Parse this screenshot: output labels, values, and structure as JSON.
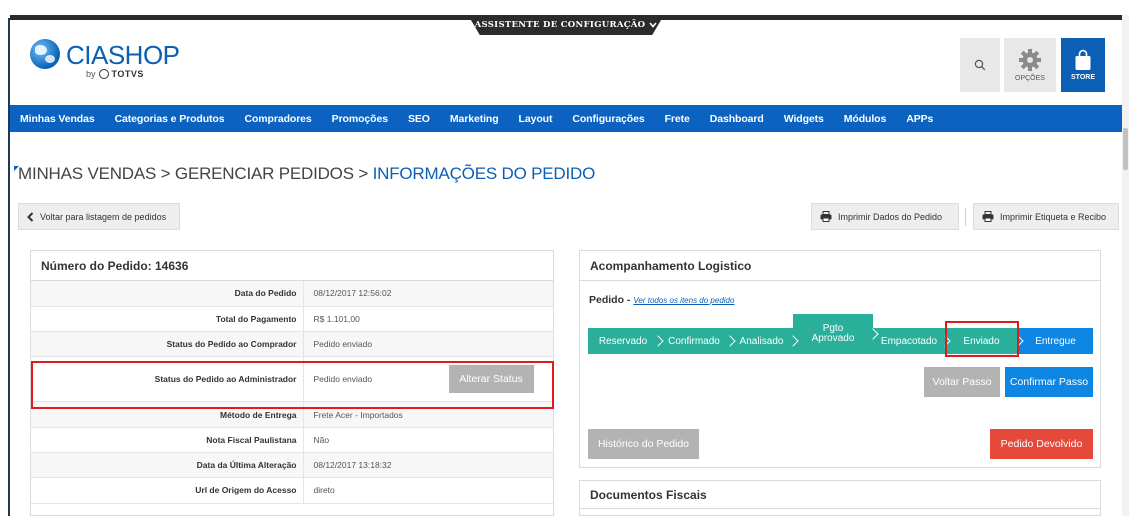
{
  "header": {
    "config_tab": "ASSISTENTE DE CONFIGURAÇÃO",
    "logo_text": "CIASHOP",
    "logo_by": "by",
    "logo_totvs": "TOTVS",
    "options_label": "OPÇÕES",
    "store_label": "STORE"
  },
  "nav": {
    "items": [
      "Minhas Vendas",
      "Categorias e Produtos",
      "Compradores",
      "Promoções",
      "SEO",
      "Marketing",
      "Layout",
      "Configurações",
      "Frete",
      "Dashboard",
      "Widgets",
      "Módulos",
      "APPs"
    ]
  },
  "breadcrumb": {
    "part1": "MINHAS VENDAS > GERENCIAR PEDIDOS > ",
    "current": "INFORMAÇÕES DO PEDIDO"
  },
  "actions": {
    "back": "Voltar para listagem de pedidos",
    "print_data": "Imprimir Dados do Pedido",
    "print_label": "Imprimir Etiqueta e Recibo"
  },
  "order": {
    "title": "Número do Pedido: 14636",
    "rows": [
      {
        "label": "Data do Pedido",
        "value": "08/12/2017 12:56:02"
      },
      {
        "label": "Total do Pagamento",
        "value": "R$ 1.101,00"
      },
      {
        "label": "Status do Pedido ao Comprador",
        "value": "Pedido enviado"
      },
      {
        "label": "Status do Pedido ao Administrador",
        "value": "Pedido enviado"
      },
      {
        "label": "Método de Entrega",
        "value": "Frete Acer - Importados"
      },
      {
        "label": "Nota Fiscal Paulistana",
        "value": "Não"
      },
      {
        "label": "Data da Última Alteração",
        "value": "08/12/2017 13:18:32"
      },
      {
        "label": "Url de Origem do Acesso",
        "value": "direto"
      }
    ],
    "alter_status": "Alterar Status"
  },
  "logistics": {
    "title": "Acompanhamento Logistico",
    "pedido_label": "Pedido - ",
    "pedido_link": "Ver todos os itens do pedido",
    "steps": [
      "Reservado",
      "Confirmado",
      "Analisado",
      "Pgto Aprovado",
      "Empacotado",
      "Enviado",
      "Entregue"
    ],
    "voltar_passo": "Voltar Passo",
    "confirmar_passo": "Confirmar Passo",
    "historico": "Histórico do Pedido",
    "devolvido": "Pedido Devolvido",
    "colors": {
      "done": "#2ab09a",
      "pending": "#0e86e3",
      "highlight": "#e01b1b"
    }
  },
  "docs": {
    "title": "Documentos Fiscais"
  }
}
